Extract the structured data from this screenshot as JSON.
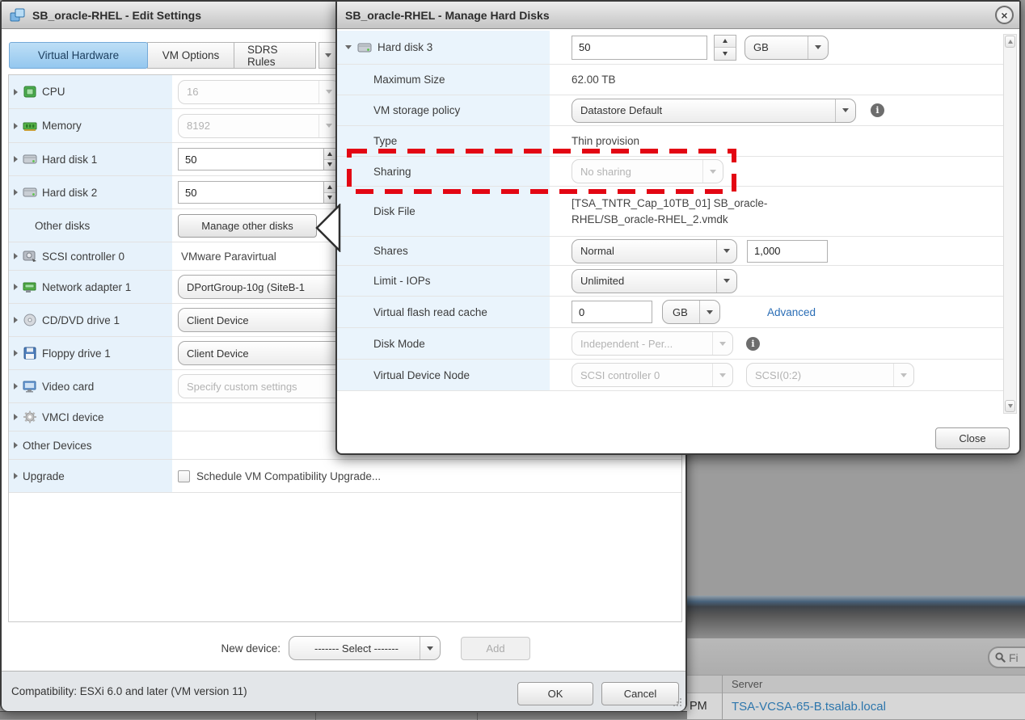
{
  "edit_dialog": {
    "title": "SB_oracle-RHEL - Edit Settings",
    "tabs": [
      "Virtual Hardware",
      "VM Options",
      "SDRS Rules"
    ],
    "rows": [
      {
        "label": "CPU",
        "value": "16"
      },
      {
        "label": "Memory",
        "value": "8192"
      },
      {
        "label": "Hard disk 1",
        "value": "50"
      },
      {
        "label": "Hard disk 2",
        "value": "50"
      },
      {
        "label": "Other disks",
        "value": "Manage other disks"
      },
      {
        "label": "SCSI controller 0",
        "value": "VMware Paravirtual"
      },
      {
        "label": "Network adapter 1",
        "value": "DPortGroup-10g (SiteB-1"
      },
      {
        "label": "CD/DVD drive 1",
        "value": "Client Device"
      },
      {
        "label": "Floppy drive 1",
        "value": "Client Device"
      },
      {
        "label": "Video card",
        "value": "Specify custom settings"
      },
      {
        "label": "VMCI device",
        "value": ""
      },
      {
        "label": "Other Devices",
        "value": ""
      },
      {
        "label": "Upgrade",
        "value": "Schedule VM Compatibility Upgrade..."
      }
    ],
    "new_device": {
      "label": "New device:",
      "value": "------- Select -------",
      "add": "Add"
    },
    "footer": {
      "compatibility": "Compatibility: ESXi 6.0 and later (VM version 11)",
      "ok": "OK",
      "cancel": "Cancel"
    }
  },
  "manage_dialog": {
    "title": "SB_oracle-RHEL - Manage Hard Disks",
    "disk": {
      "label": "Hard disk 3",
      "value": "50",
      "unit": "GB"
    },
    "rows": [
      {
        "label": "Maximum Size",
        "value": "62.00 TB"
      },
      {
        "label": "VM storage policy",
        "value": "Datastore Default"
      },
      {
        "label": "Type",
        "value": "Thin provision"
      },
      {
        "label": "Sharing",
        "value": "No sharing"
      },
      {
        "label": "Disk File",
        "value": "[TSA_TNTR_Cap_10TB_01] SB_oracle-RHEL/SB_oracle-RHEL_2.vmdk"
      },
      {
        "label": "Shares",
        "value": "Normal",
        "value2": "1,000"
      },
      {
        "label": "Limit - IOPs",
        "value": "Unlimited"
      },
      {
        "label": "Virtual flash read cache",
        "value": "0",
        "unit": "GB",
        "link": "Advanced"
      },
      {
        "label": "Disk Mode",
        "value": "Independent - Per..."
      },
      {
        "label": "Virtual Device Node",
        "value": "SCSI controller 0",
        "value2": "SCSI(0:2)"
      }
    ],
    "close_button": "Close"
  },
  "background": {
    "filter_text": "Fi",
    "server_header": "Server",
    "time_cell": "PM",
    "server_cell": "TSA-VCSA-65-B.tsalab.local"
  },
  "colors": {
    "annotation_red": "#e30613",
    "link_blue": "#2a6db5",
    "tab_active_blue": "#94c7ef",
    "label_column_blue": "#eaf4fc"
  }
}
